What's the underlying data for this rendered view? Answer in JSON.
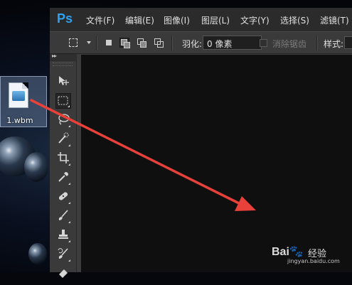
{
  "desktop": {
    "file": {
      "label": "1.wbm"
    }
  },
  "app": {
    "logo": "Ps",
    "menu": [
      "文件(F)",
      "编辑(E)",
      "图像(I)",
      "图层(L)",
      "文字(Y)",
      "选择(S)",
      "滤镜(T)"
    ]
  },
  "options_bar": {
    "feather_label": "羽化:",
    "feather_value": "0 像素",
    "antialias_label": "消除锯齿",
    "style_label": "样式:"
  },
  "toolbar": {
    "collapse_glyph": "▸▸",
    "tools": [
      "move-tool",
      "rectangular-marquee-tool",
      "lasso-tool",
      "quick-selection-tool",
      "crop-tool",
      "eyedropper-tool",
      "spot-healing-brush-tool",
      "brush-tool",
      "clone-stamp-tool",
      "history-brush-tool",
      "eraser-tool"
    ]
  },
  "annotation": {
    "arrow_color": "#e8413a"
  },
  "watermark": {
    "logo": "Bai🐾",
    "text": "经验",
    "url": "jingyan.baidu.com"
  }
}
